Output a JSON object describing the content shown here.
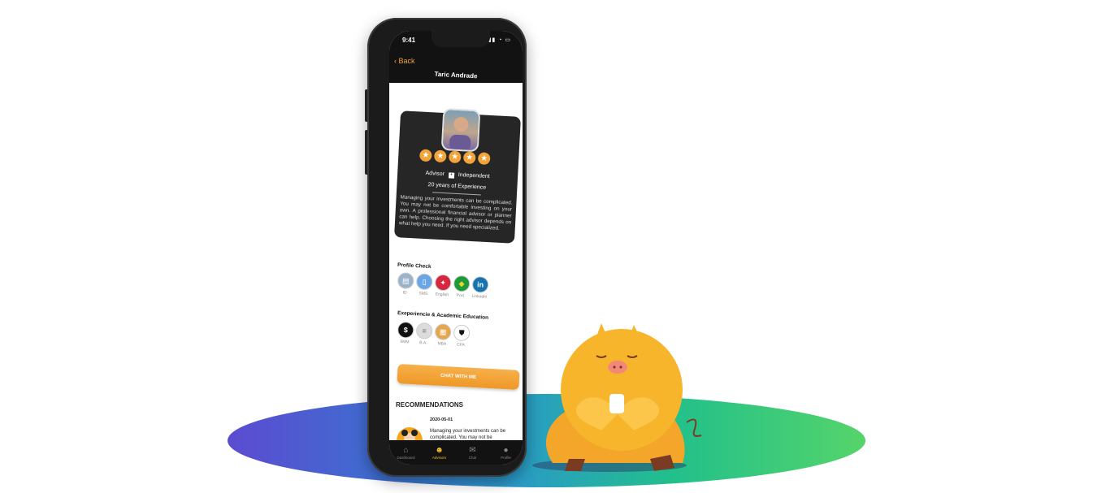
{
  "statusbar": {
    "time": "9:41"
  },
  "nav": {
    "back_label": "Back",
    "title": "Taric Andrade"
  },
  "profile": {
    "rating_stars": 5,
    "role": "Advisor",
    "type": "Independent",
    "experience": "20 years of Experience",
    "description": "Managing your investments can be complicated. You may not be comfortable investing on your own. A professional financial advisor or planner can help. Choosing the right advisor depends on what help you need. If you need specialized."
  },
  "profile_check": {
    "title": "Profile Check",
    "items": [
      {
        "label": "ID",
        "icon": "id-card-icon"
      },
      {
        "label": "SMS",
        "icon": "sms-icon"
      },
      {
        "label": "English",
        "icon": "canada-flag-icon"
      },
      {
        "label": "Port.",
        "icon": "brazil-flag-icon"
      },
      {
        "label": "Linkedin",
        "icon": "linkedin-icon"
      }
    ]
  },
  "education": {
    "title": "Exeperiencie & Academic Education",
    "items": [
      {
        "label": "5MM",
        "icon": "dollar-icon"
      },
      {
        "label": "B.A.",
        "icon": "document-icon"
      },
      {
        "label": "MBA",
        "icon": "certificate-icon"
      },
      {
        "label": "CFA",
        "icon": "shield-icon"
      }
    ]
  },
  "chat_button": "CHAT WITH ME",
  "recommendations": {
    "title": "RECOMMENDATIONS",
    "date": "2020-05-01",
    "text": "Managing your investments can be complicated. You may not be comfortable investing on your own. A professional financial advisor or planner can help. Choosing the right advisor depends on what help you need."
  },
  "tabs": [
    {
      "label": "Dashboard",
      "icon": "home-icon",
      "glyph": "⌂"
    },
    {
      "label": "Advisors",
      "icon": "people-icon",
      "glyph": "☻"
    },
    {
      "label": "Chat",
      "icon": "chat-icon",
      "glyph": "✉"
    },
    {
      "label": "Profile",
      "icon": "user-icon",
      "glyph": "●"
    }
  ],
  "colors": {
    "accent": "#f2a33a",
    "active_tab": "#f2c12a",
    "dark": "#121212"
  }
}
